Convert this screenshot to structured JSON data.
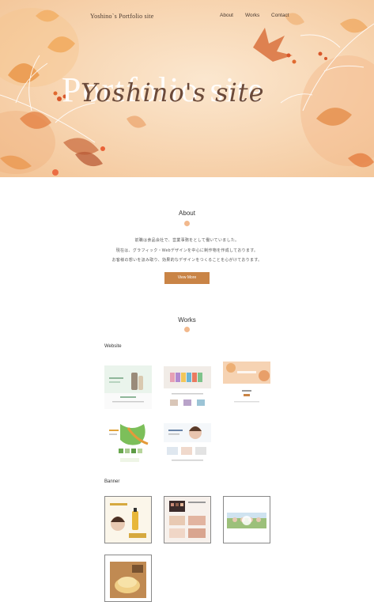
{
  "header": {
    "logo_text": "Yoshino`s Portfolio site",
    "nav": [
      "About",
      "Works",
      "Contact"
    ]
  },
  "hero": {
    "bg_word": "Portfolio site",
    "script_word": "Yoshino's site"
  },
  "about": {
    "title": "About",
    "lines": [
      "前職は食品会社で、営業事務をとして働いていました。",
      "現在は、グラフィック・Webデザインを中心に制作物を作成しております。",
      "お客様の想いを汲み取り、効果的なデザインをつくることを心がけております。"
    ],
    "button_label": "View More"
  },
  "works": {
    "title": "Works",
    "website_label": "Website",
    "banner_label": "Banner"
  },
  "colors": {
    "accent": "#c98446",
    "dot": "#f2b98d",
    "hero_bg": "#f8d8b6"
  }
}
